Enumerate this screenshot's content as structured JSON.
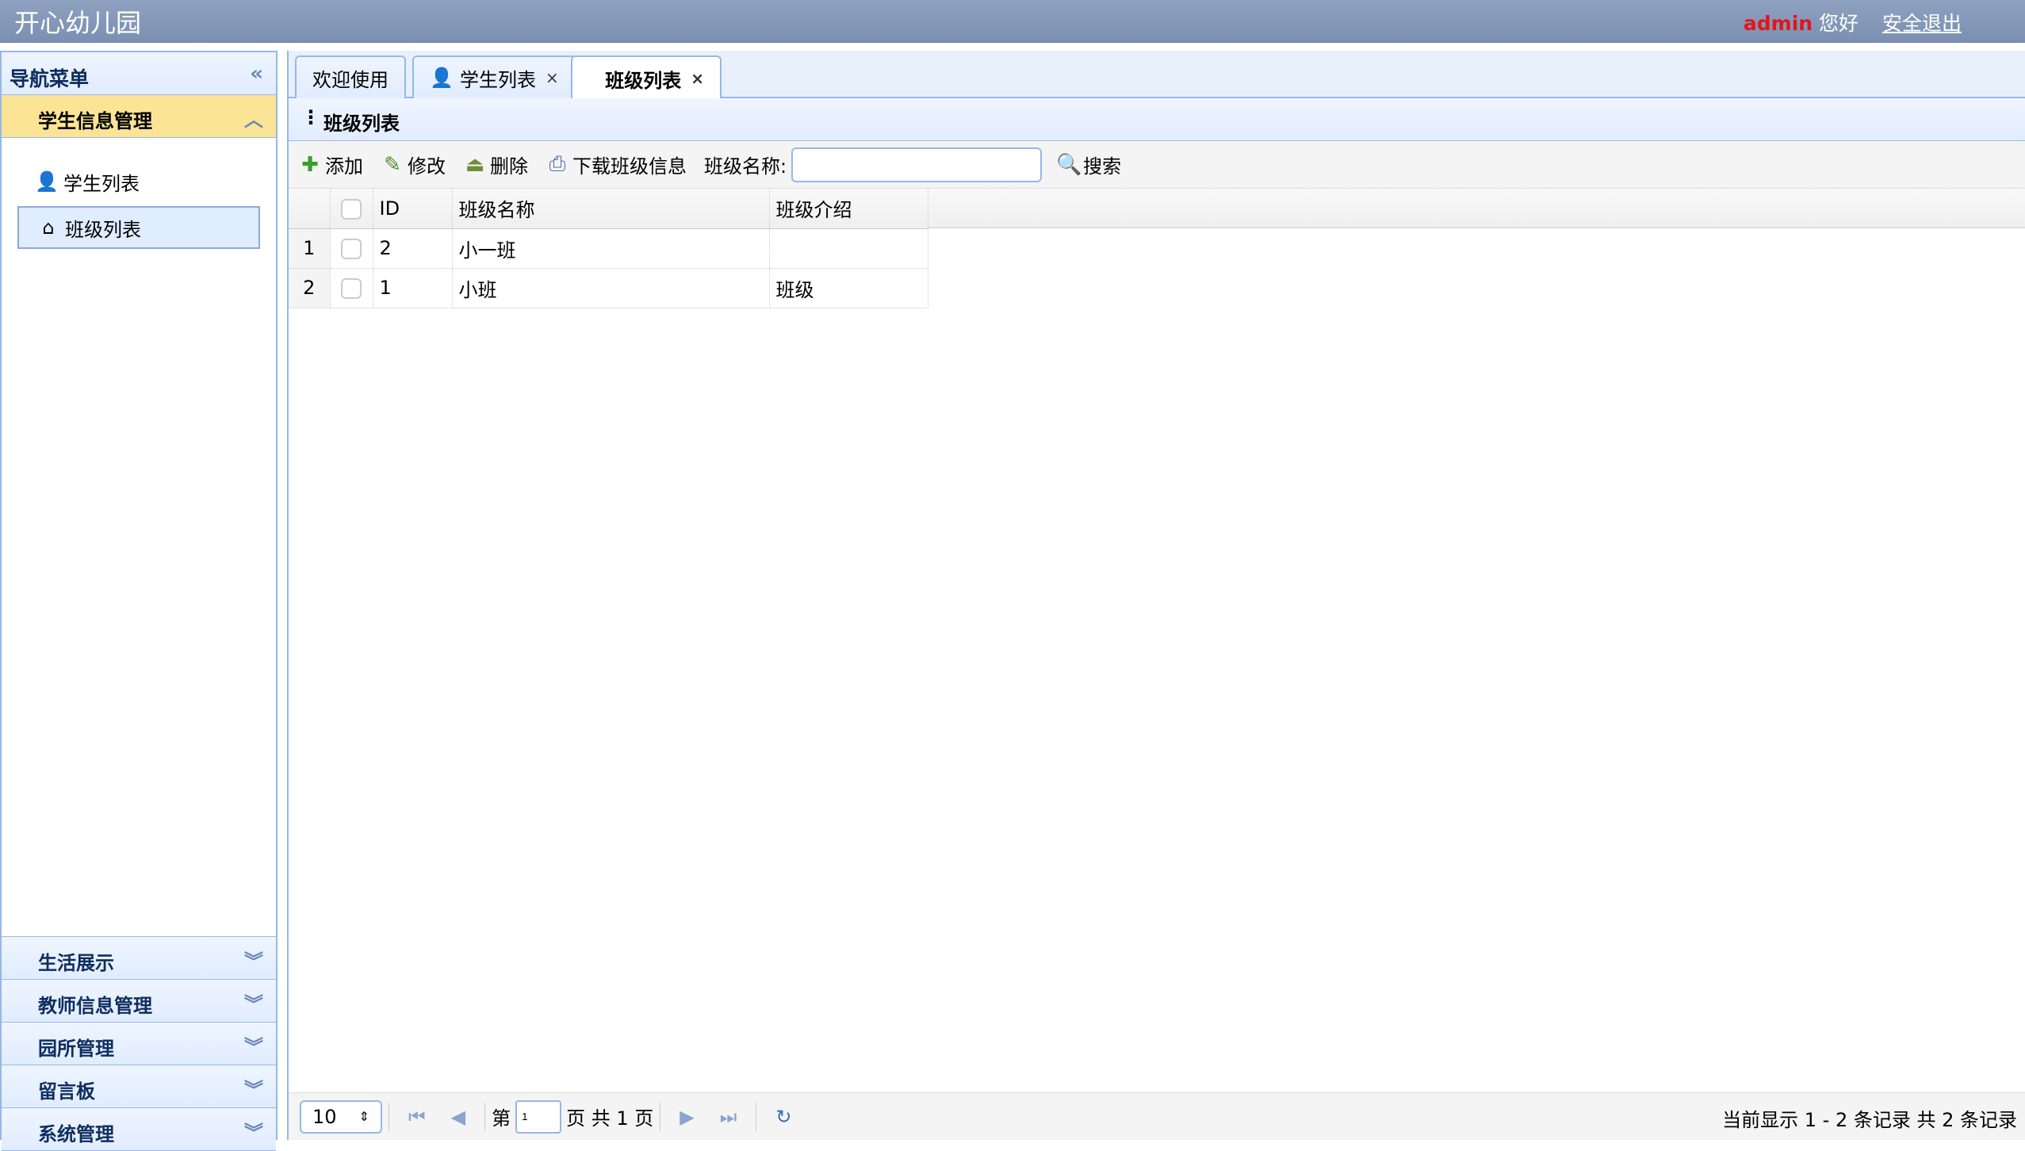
{
  "app": {
    "title": "开心幼儿园",
    "user": "admin",
    "greeting": "您好",
    "logout": "安全退出"
  },
  "sidebar": {
    "title": "导航菜单",
    "collapse_icon": "double-chevron-left-icon",
    "sections": [
      {
        "label": "学生信息管理",
        "expanded": true,
        "items": [
          {
            "label": "学生列表",
            "icon": "student-icon"
          },
          {
            "label": "班级列表",
            "icon": "home-icon",
            "selected": true
          }
        ]
      },
      {
        "label": "生活展示"
      },
      {
        "label": "教师信息管理"
      },
      {
        "label": "园所管理"
      },
      {
        "label": "留言板"
      },
      {
        "label": "系统管理"
      }
    ]
  },
  "tabs": [
    {
      "label": "欢迎使用"
    },
    {
      "label": "学生列表",
      "icon": "student-icon",
      "closable": true
    },
    {
      "label": "班级列表",
      "closable": true,
      "active": true
    }
  ],
  "panel": {
    "title": "班级列表"
  },
  "toolbar": {
    "add": "添加",
    "edit": "修改",
    "delete": "删除",
    "download": "下载班级信息",
    "search_label": "班级名称:",
    "search_value": "",
    "search_button": "搜索"
  },
  "grid": {
    "columns": [
      "ID",
      "班级名称",
      "班级介绍"
    ],
    "rows": [
      {
        "row_num": "1",
        "id": "2",
        "name": "小一班",
        "intro": ""
      },
      {
        "row_num": "2",
        "id": "1",
        "name": "小班",
        "intro": "班级"
      }
    ]
  },
  "pager": {
    "page_size": "10",
    "page_prefix": "第",
    "page_num": "1",
    "page_suffix": "页 共 1 页",
    "info": "当前显示 1 - 2 条记录 共 2 条记录"
  },
  "colors": {
    "accent_border": "#95b8e7",
    "selected_section": "#fbe495",
    "admin": "#e4141b",
    "topbar": "#8ea1c0"
  }
}
